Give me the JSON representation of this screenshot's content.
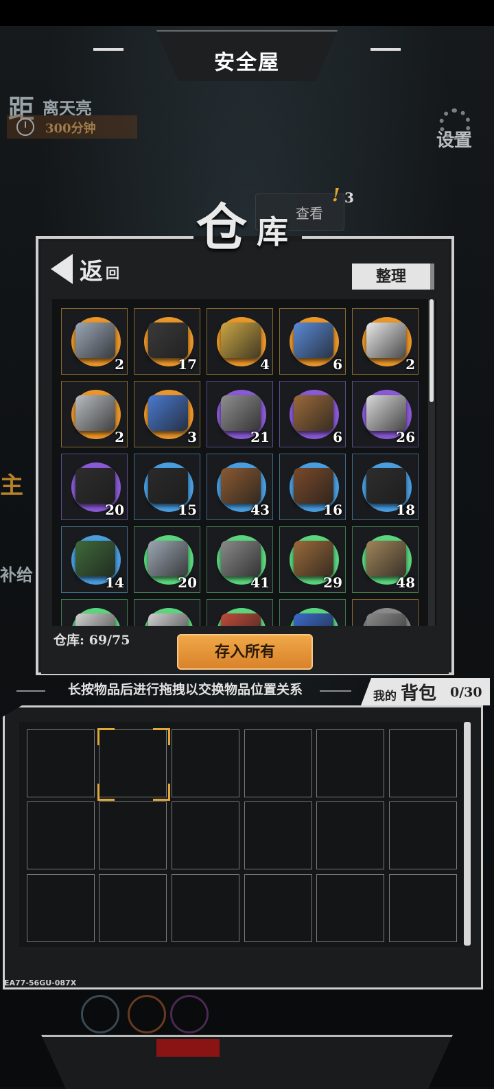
{
  "header": {
    "title": "安全屋"
  },
  "timer": {
    "big": "距",
    "label": "离天亮",
    "value": "300分钟"
  },
  "settings": {
    "label": "设置"
  },
  "notice": {
    "label": "查看",
    "alert": "!",
    "count": "3"
  },
  "side": {
    "left_label_1": "主",
    "left_label_2": "补给"
  },
  "panel": {
    "title_big": "仓",
    "title_small": "库",
    "back_big": "返",
    "back_small": "回",
    "sort_label": "整理",
    "storage_count": "仓库: 69/75",
    "deposit_label": "存入所有"
  },
  "items": [
    {
      "name": "blue-plate",
      "rarity": "orange",
      "count": "2"
    },
    {
      "name": "pipe-bundle",
      "rarity": "orange",
      "count": "17"
    },
    {
      "name": "gold-cloth",
      "rarity": "orange",
      "count": "4"
    },
    {
      "name": "blue-bottle",
      "rarity": "orange",
      "count": "6"
    },
    {
      "name": "medicine-jar",
      "rarity": "orange",
      "count": "2"
    },
    {
      "name": "gas-canister",
      "rarity": "orange",
      "count": "2"
    },
    {
      "name": "crystal-cube",
      "rarity": "orange",
      "count": "3"
    },
    {
      "name": "metal-ingots",
      "rarity": "purple",
      "count": "21"
    },
    {
      "name": "wood-planks",
      "rarity": "purple",
      "count": "6"
    },
    {
      "name": "white-cloth",
      "rarity": "purple",
      "count": "26"
    },
    {
      "name": "microchip",
      "rarity": "purple",
      "count": "20"
    },
    {
      "name": "coal",
      "rarity": "blue",
      "count": "15"
    },
    {
      "name": "wood-scraps",
      "rarity": "blue",
      "count": "43"
    },
    {
      "name": "leather",
      "rarity": "blue",
      "count": "16"
    },
    {
      "name": "battery",
      "rarity": "blue",
      "count": "18"
    },
    {
      "name": "circuit-board",
      "rarity": "blue",
      "count": "14"
    },
    {
      "name": "iron-ingots",
      "rarity": "green",
      "count": "20"
    },
    {
      "name": "nuts-bolts",
      "rarity": "green",
      "count": "41"
    },
    {
      "name": "lumber",
      "rarity": "green",
      "count": "29"
    },
    {
      "name": "burlap",
      "rarity": "green",
      "count": "48"
    },
    {
      "name": "tape",
      "rarity": "green",
      "count": ""
    },
    {
      "name": "flask",
      "rarity": "green",
      "count": ""
    },
    {
      "name": "wire",
      "rarity": "green",
      "count": ""
    },
    {
      "name": "pills",
      "rarity": "green",
      "count": ""
    },
    {
      "name": "scrap",
      "rarity": "grey",
      "count": ""
    }
  ],
  "rarity_colors": {
    "orange": "#e9962a",
    "purple": "#8a5ad6",
    "blue": "#4a9ee0",
    "green": "#5bd67e",
    "grey": "#8a8a8a"
  },
  "hint": "长按物品后进行拖拽以交换物品位置关系",
  "backpack": {
    "small": "我的",
    "big": "背包",
    "count": "0/30"
  },
  "serial": "EA77-56GU-087X"
}
